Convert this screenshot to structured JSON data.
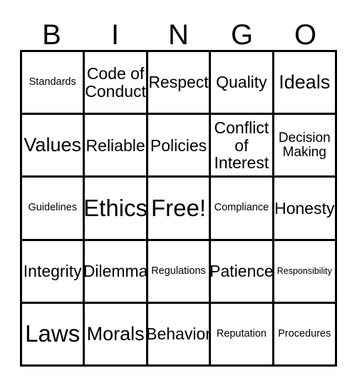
{
  "card": {
    "title": "BINGO",
    "header_letters": [
      "B",
      "I",
      "N",
      "G",
      "O"
    ],
    "colors": {
      "border": "#000000",
      "background": "#ffffff",
      "text": "#000000"
    },
    "grid": {
      "rows": 5,
      "columns": 5,
      "free_space": "Free!",
      "free_space_position": [
        2,
        2
      ]
    },
    "cells": [
      [
        {
          "label": "Standards",
          "size": "xs"
        },
        {
          "label": "Code of Conduct",
          "size": "md"
        },
        {
          "label": "Respect",
          "size": "md"
        },
        {
          "label": "Quality",
          "size": "md"
        },
        {
          "label": "Ideals",
          "size": "lg"
        }
      ],
      [
        {
          "label": "Values",
          "size": "lg"
        },
        {
          "label": "Reliable",
          "size": "md"
        },
        {
          "label": "Policies",
          "size": "md"
        },
        {
          "label": "Conflict of Interest",
          "size": "md"
        },
        {
          "label": "Decision Making",
          "size": "sm"
        }
      ],
      [
        {
          "label": "Guidelines",
          "size": "xs"
        },
        {
          "label": "Ethics",
          "size": "xl"
        },
        {
          "label": "Free!",
          "size": "xl"
        },
        {
          "label": "Compliance",
          "size": "xs"
        },
        {
          "label": "Honesty",
          "size": "md"
        }
      ],
      [
        {
          "label": "Integrity",
          "size": "md"
        },
        {
          "label": "Dilemma",
          "size": "md"
        },
        {
          "label": "Regulations",
          "size": "xs"
        },
        {
          "label": "Patience",
          "size": "md"
        },
        {
          "label": "Responsibility",
          "size": "xxs"
        }
      ],
      [
        {
          "label": "Laws",
          "size": "xl"
        },
        {
          "label": "Morals",
          "size": "lg"
        },
        {
          "label": "Behavior",
          "size": "md"
        },
        {
          "label": "Reputation",
          "size": "xs"
        },
        {
          "label": "Procedures",
          "size": "xs"
        }
      ]
    ]
  }
}
